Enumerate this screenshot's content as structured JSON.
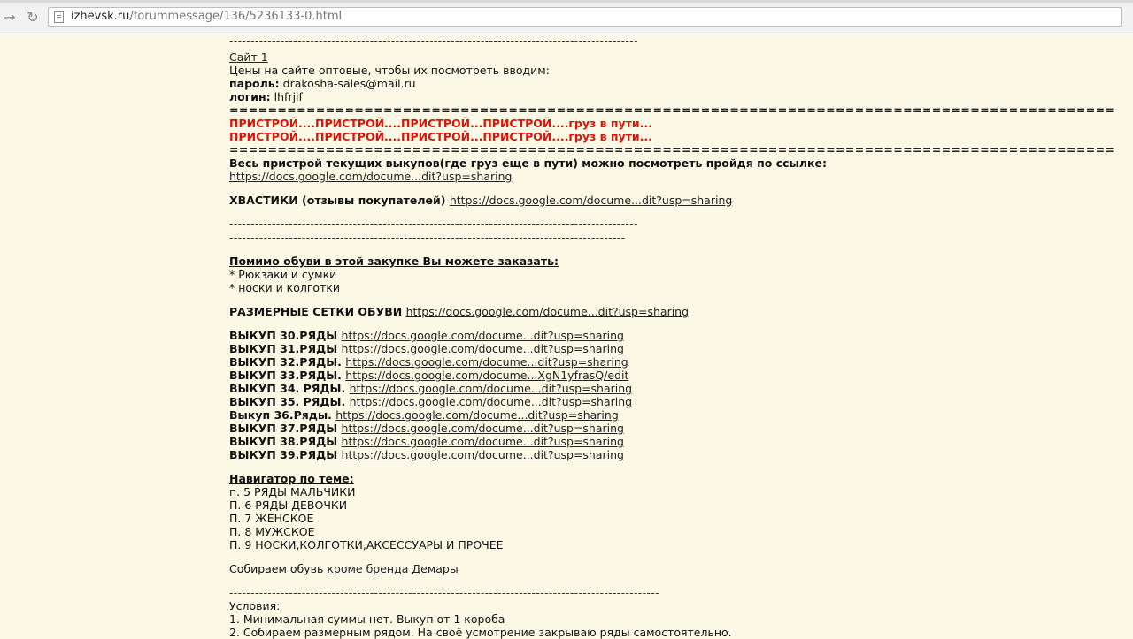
{
  "browser": {
    "url_domain": "izhevsk.ru",
    "url_path": "/forummessage/136/5236133-0.html"
  },
  "content": {
    "sep1": "------------------------------------------------------------------------------------------------",
    "site_link": "Сайт 1 ",
    "prices_text": "Цены на сайте оптовые, чтобы их посмотреть вводим:",
    "password_label": "пароль:",
    "password_value": " drakosha-sales@mail.ru",
    "login_label": "логин:",
    "login_value": " lhfrjif",
    "eq_sep": "=====================================================================================================",
    "red_line1": "ПРИСТРОЙ....ПРИСТРОЙ....ПРИСТРОЙ...ПРИСТРОЙ....груз в пути...",
    "red_line2": "ПРИСТРОЙ....ПРИСТРОЙ....ПРИСТРОЙ...ПРИСТРОЙ....груз в пути...",
    "eq_sep2": "=====================================================================================================",
    "pristroy_text": "Весь пристрой текущих выкупов(где груз еще в пути) можно посмотреть пройдя по ссылке:",
    "pristroy_link": "https://docs.google.com/docume...dit?usp=sharing",
    "reviews_label": "ХВАСТИКИ (отзывы покупателей) ",
    "reviews_link": "https://docs.google.com/docume...dit?usp=sharing",
    "sep2": "------------------------------------------------------------------------------------------------",
    "sep3": "---------------------------------------------------------------------------------------------",
    "besides_heading": "Помимо обуви в этой закупке Вы можете заказать:",
    "besides_item1": "* Рюкзаки и сумки",
    "besides_item2": "* носки и колготки",
    "size_label": "РАЗМЕРНЫЕ СЕТКИ ОБУВИ ",
    "size_link": "https://docs.google.com/docume...dit?usp=sharing",
    "buyouts": [
      {
        "label": "ВЫКУП 30.РЯДЫ ",
        "link": "https://docs.google.com/docume...dit?usp=sharing"
      },
      {
        "label": "ВЫКУП 31.РЯДЫ ",
        "link": "https://docs.google.com/docume...dit?usp=sharing"
      },
      {
        "label": "ВЫКУП 32.РЯДЫ. ",
        "link": "https://docs.google.com/docume...dit?usp=sharing"
      },
      {
        "label": "ВЫКУП 33.РЯДЫ. ",
        "link": "https://docs.google.com/docume...XgN1yfrasQ/edit"
      },
      {
        "label": "ВЫКУП 34. РЯДЫ. ",
        "link": "https://docs.google.com/docume...dit?usp=sharing"
      },
      {
        "label": "ВЫКУП 35. РЯДЫ. ",
        "link": "https://docs.google.com/docume...dit?usp=sharing"
      },
      {
        "label": "Выкуп 36.Ряды. ",
        "link": "https://docs.google.com/docume...dit?usp=sharing"
      },
      {
        "label": "ВЫКУП 37.РЯДЫ ",
        "link": "https://docs.google.com/docume...dit?usp=sharing"
      },
      {
        "label": "ВЫКУП 38.РЯДЫ ",
        "link": "https://docs.google.com/docume...dit?usp=sharing"
      },
      {
        "label": "ВЫКУП 39.РЯДЫ ",
        "link": "https://docs.google.com/docume...dit?usp=sharing"
      }
    ],
    "navigator_heading": "Навигатор по теме:",
    "navigator_items": [
      "п. 5 РЯДЫ МАЛЬЧИКИ",
      "П. 6 РЯДЫ ДЕВОЧКИ",
      "П. 7 ЖЕНСКОЕ",
      "П. 8 МУЖСКОЕ",
      "П. 9 НОСКИ,КОЛГОТКИ,АКСЕССУАРЫ И ПРОЧЕЕ"
    ],
    "collect_text": "Собираем обувь ",
    "collect_link": "кроме бренда Демары",
    "sep4": "-----------------------------------------------------------------------------------------------------",
    "conditions_title": "Условия:",
    "condition1": "1. Минимальная суммы нет. Выкуп от 1 короба",
    "condition2": "2. Собираем размерным рядом. На своё усмотрение закрываю ряды самостоятельно."
  }
}
